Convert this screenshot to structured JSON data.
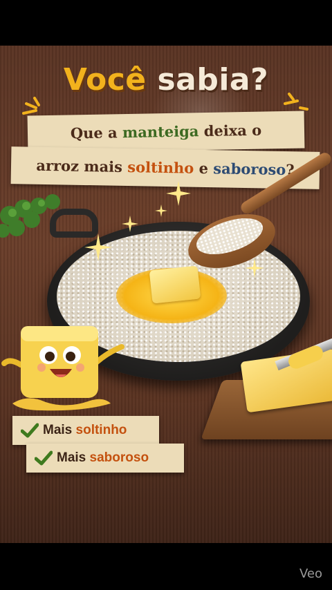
{
  "headline": {
    "word1": "Você",
    "word2": "sabia?"
  },
  "banner_line1": {
    "pre": "Que a ",
    "highlight": "manteiga",
    "post": " deixa o"
  },
  "banner_line2": {
    "pre": "arroz mais ",
    "hl1": "soltinho",
    "mid": " e ",
    "hl2": "saboroso",
    "post": "?"
  },
  "benefits": [
    {
      "pre": "Mais ",
      "highlight": "soltinho"
    },
    {
      "pre": "Mais ",
      "highlight": "saboroso"
    }
  ],
  "watermark": "Veo",
  "colors": {
    "headline_yellow": "#f2b21d",
    "banner_bg": "#ecdcb8",
    "highlight_green": "#3d6a22",
    "highlight_orange": "#c4510f",
    "highlight_blue": "#2d4b73",
    "check_green": "#3f7a1e"
  },
  "icons": [
    "sparkle-icon",
    "check-icon"
  ]
}
